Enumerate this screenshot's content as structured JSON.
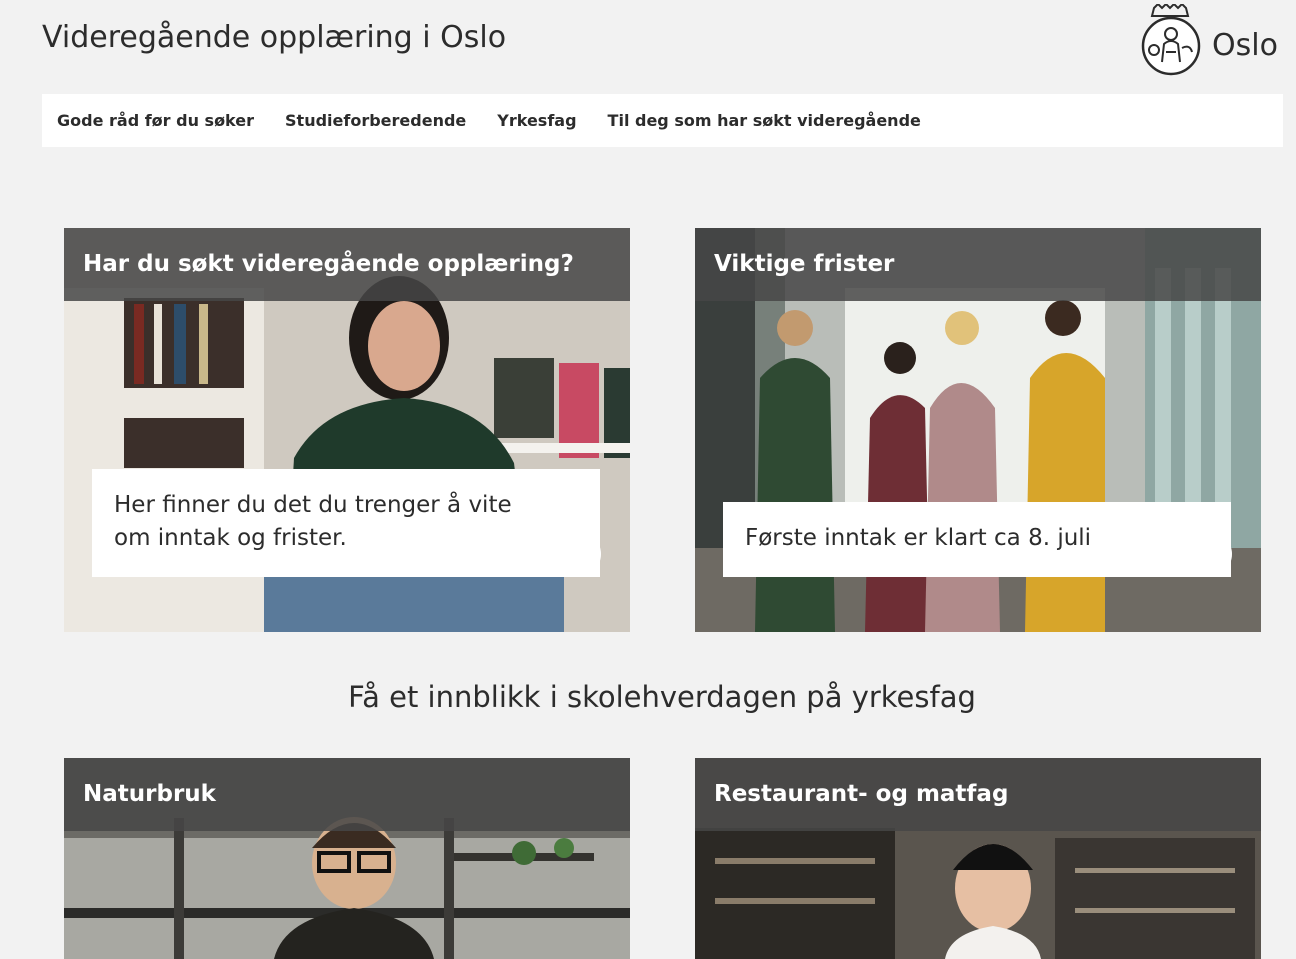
{
  "header": {
    "title": "Videregående opplæring i Oslo",
    "logo_text": "Oslo",
    "logo_icon": "oslo-city-seal-icon"
  },
  "nav": {
    "items": [
      {
        "label": "Gode råd før du søker"
      },
      {
        "label": "Studieforberedende"
      },
      {
        "label": "Yrkesfag"
      },
      {
        "label": "Til deg som har søkt videregående"
      }
    ]
  },
  "cards_top": [
    {
      "title": "Har du søkt videregående opplæring?",
      "caption": "Her finner du det du trenger å vite om inntak og frister."
    },
    {
      "title": "Viktige frister",
      "caption": "Første inntak er klart ca 8. juli"
    }
  ],
  "section": {
    "heading": "Få et innblikk i skolehverdagen på yrkesfag"
  },
  "cards_bottom": [
    {
      "title": "Naturbruk"
    },
    {
      "title": "Restaurant- og matfag"
    }
  ],
  "colors": {
    "background": "#f2f2f2",
    "card_header": "#464646",
    "nav_bg": "#ffffff"
  }
}
